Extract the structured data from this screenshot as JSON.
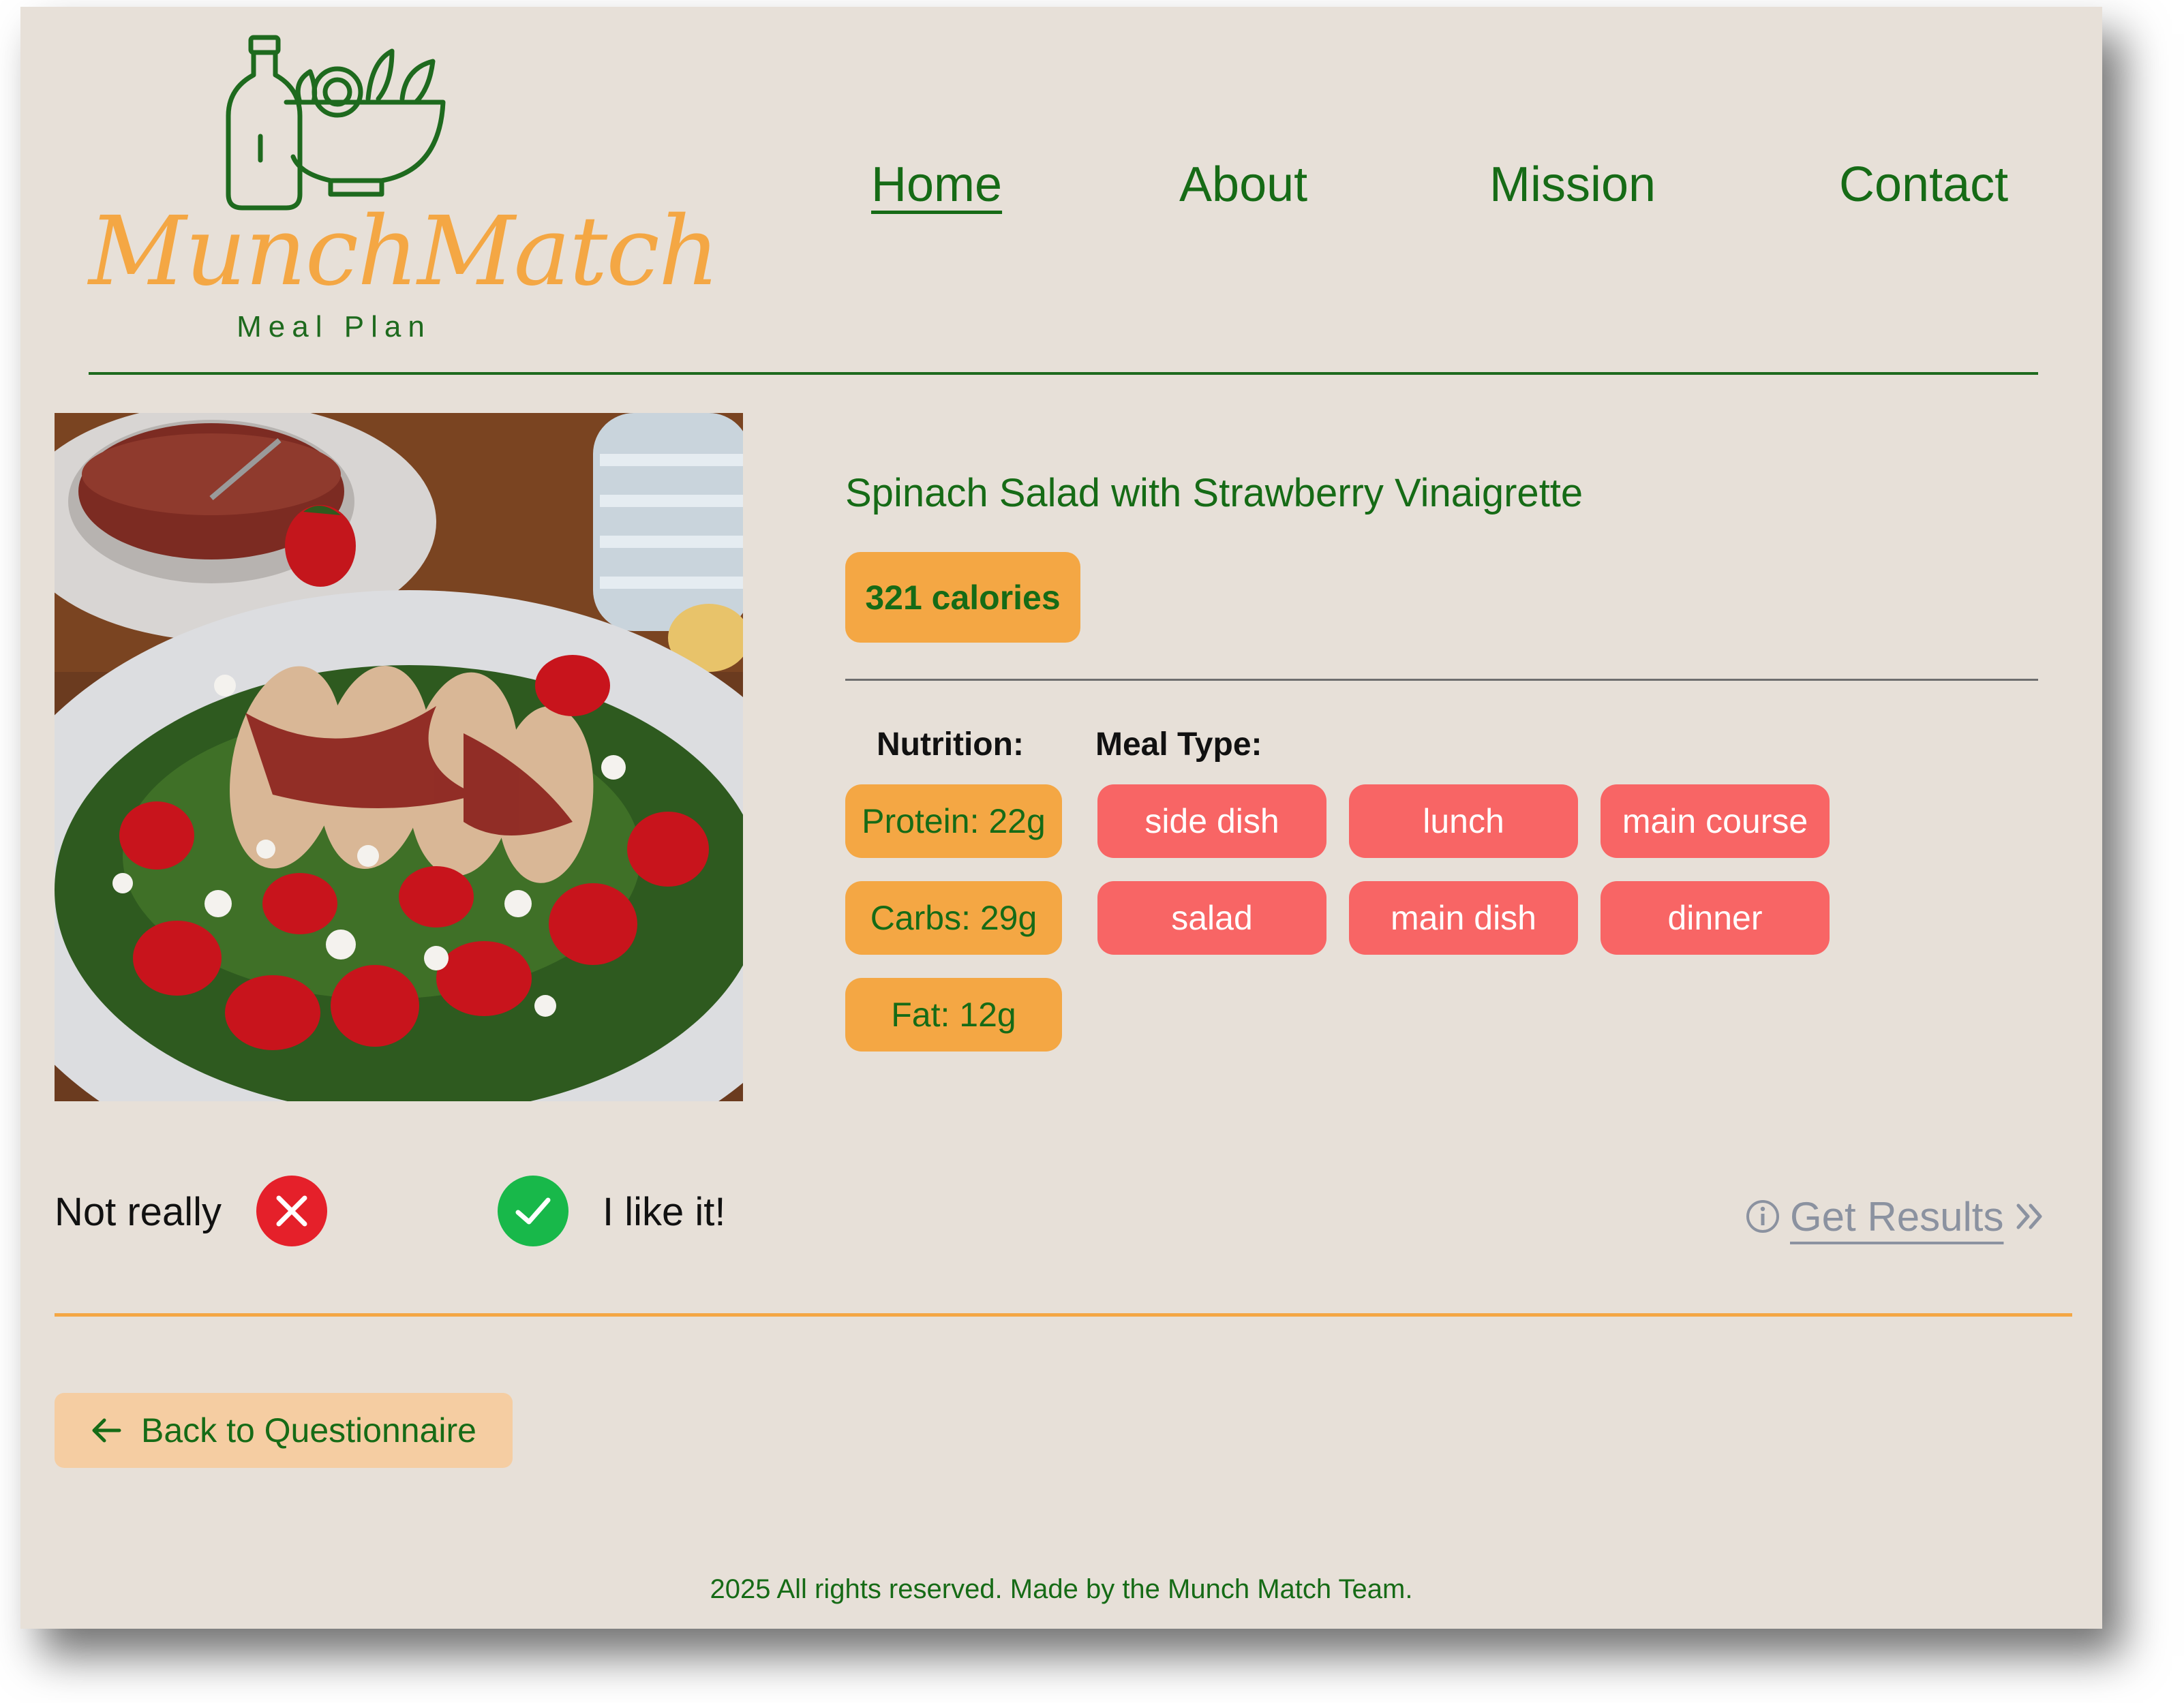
{
  "brand": {
    "name": "MunchMatch",
    "subtitle": "Meal Plan",
    "color": "#f4a744",
    "secondary_color": "#1e6a1e"
  },
  "nav": {
    "items": [
      {
        "label": "Home",
        "active": true
      },
      {
        "label": "About",
        "active": false
      },
      {
        "label": "Mission",
        "active": false
      },
      {
        "label": "Contact",
        "active": false
      }
    ]
  },
  "recipe": {
    "title": "Spinach Salad with Strawberry Vinaigrette",
    "calories": "321 calories",
    "nutrition_label": "Nutrition:",
    "meal_type_label": "Meal Type:",
    "nutrition": [
      "Protein: 22g",
      "Carbs: 29g",
      "Fat: 12g"
    ],
    "meal_types": [
      "side dish",
      "lunch",
      "main course",
      "salad",
      "main dish",
      "dinner"
    ]
  },
  "vote": {
    "no_label": "Not really",
    "yes_label": "I like it!",
    "no_icon": "x-icon",
    "yes_icon": "check-icon"
  },
  "results": {
    "label": "Get Results",
    "info_icon": "info-icon",
    "chevron_icon": "double-chevron-right-icon"
  },
  "back": {
    "label": "Back to Questionnaire",
    "icon": "arrow-left-icon"
  },
  "footer": {
    "text": "2025 All rights reserved. Made by the Munch Match Team."
  },
  "colors": {
    "background": "#e7e0d8",
    "nutrition_pill": "#f4a744",
    "meal_pill": "#f86565",
    "reject": "#e5202a",
    "accept": "#18b84a",
    "back_button": "#f5cda2"
  }
}
